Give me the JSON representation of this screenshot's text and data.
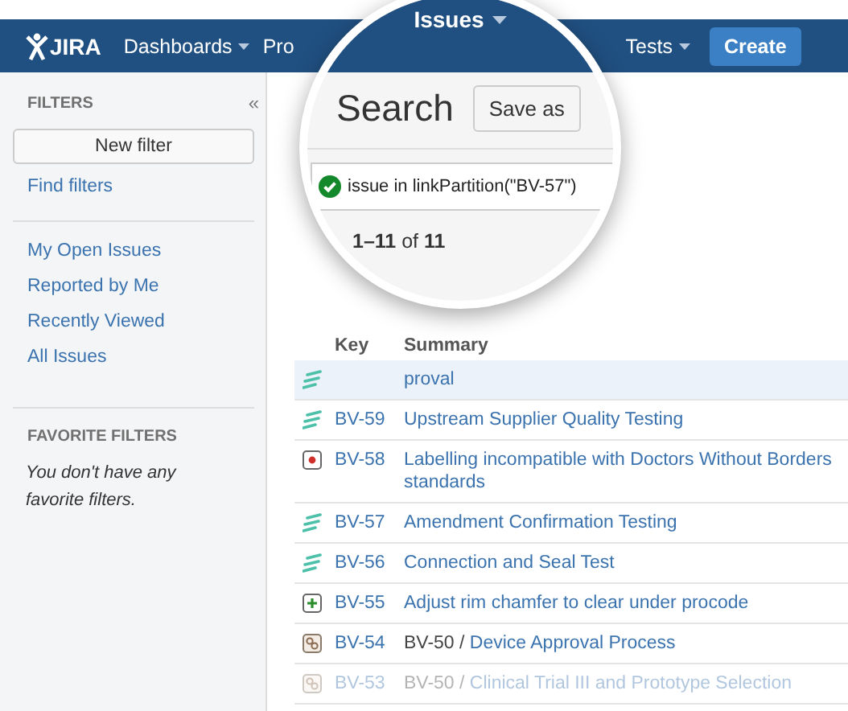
{
  "top_nav": {
    "logo": "JIRA",
    "items": [
      {
        "label": "Dashboards",
        "dropdown": true
      },
      {
        "label": "Pro",
        "dropdown": false
      },
      {
        "label": "Tests",
        "dropdown": true
      }
    ],
    "create_button": "Create"
  },
  "sidebar": {
    "heading": "FILTERS",
    "collapse": "«",
    "new_filter_button": "New filter",
    "find_filters": "Find filters",
    "filters": [
      "My Open Issues",
      "Reported by Me",
      "Recently Viewed",
      "All Issues"
    ],
    "favorites_heading": "FAVORITE FILTERS",
    "favorites_empty": "You don't have any favorite filters."
  },
  "magnifier": {
    "nav_item": {
      "label": "Issues",
      "dropdown": true
    },
    "title": "Search",
    "save_button": "Save as",
    "query": {
      "value": "issue in linkPartition(\"BV-57\")",
      "valid": true
    },
    "result_count": "**1–11** of **11**"
  },
  "table": {
    "columns": [
      "Key",
      "Summary"
    ],
    "rows": [
      {
        "kind": "test",
        "summary": "proval",
        "selected": true,
        "faded": false
      },
      {
        "kind": "test",
        "key": "BV-59",
        "summary": "Upstream Supplier Quality Testing",
        "selected": false,
        "faded": false
      },
      {
        "kind": "bug",
        "key": "BV-58",
        "summary": "Labelling incompatible with Doctors Without Borders standards",
        "selected": false,
        "faded": false
      },
      {
        "kind": "test",
        "key": "BV-57",
        "summary": "Amendment Confirmation Testing",
        "selected": false,
        "faded": false
      },
      {
        "kind": "test",
        "key": "BV-56",
        "summary": "Connection and Seal Test",
        "selected": false,
        "faded": false
      },
      {
        "kind": "feature",
        "key": "BV-55",
        "summary": "Adjust rim chamfer to clear under procode",
        "selected": false,
        "faded": false
      },
      {
        "kind": "subtask",
        "key": "BV-54",
        "parent": "BV-50 /",
        "summary": "Device Approval Process",
        "selected": false,
        "faded": false
      },
      {
        "kind": "subtask",
        "key": "BV-53",
        "parent": "BV-50 /",
        "summary": "Clinical Trial III and Prototype Selection",
        "selected": false,
        "faded": true
      }
    ]
  }
}
